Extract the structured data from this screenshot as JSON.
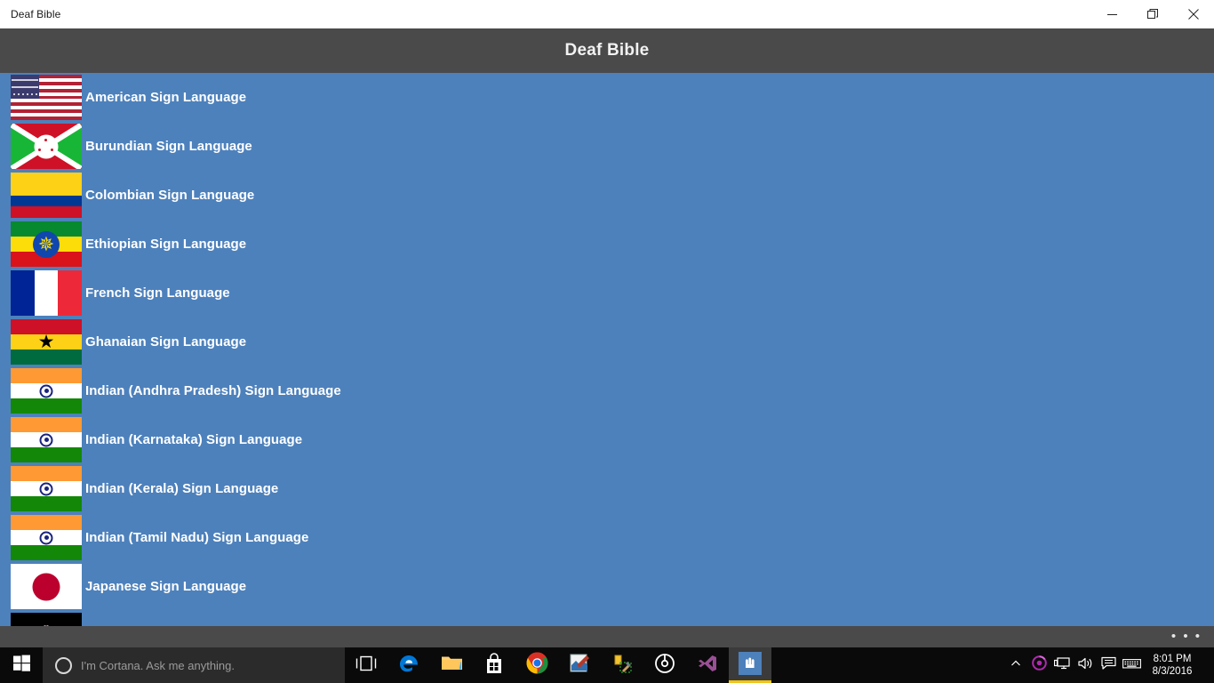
{
  "window": {
    "title": "Deaf Bible",
    "controls": [
      {
        "name": "minimize",
        "label": "Minimize"
      },
      {
        "name": "maximize",
        "label": "Restore"
      },
      {
        "name": "close",
        "label": "Close"
      }
    ]
  },
  "app": {
    "header_title": "Deaf Bible",
    "background_color": "#4d81bc",
    "header_color": "#4a4a4a",
    "appbar_more_label": "• • •"
  },
  "languages": [
    {
      "name": "American Sign Language",
      "flag": "us"
    },
    {
      "name": "Burundian Sign Language",
      "flag": "bi"
    },
    {
      "name": "Colombian Sign Language",
      "flag": "co"
    },
    {
      "name": "Ethiopian Sign Language",
      "flag": "et"
    },
    {
      "name": "French Sign Language",
      "flag": "fr"
    },
    {
      "name": "Ghanaian Sign Language",
      "flag": "gh"
    },
    {
      "name": "Indian (Andhra Pradesh) Sign Language",
      "flag": "in"
    },
    {
      "name": "Indian (Karnataka) Sign Language",
      "flag": "in"
    },
    {
      "name": "Indian (Kerala) Sign Language",
      "flag": "in"
    },
    {
      "name": "Indian (Tamil Nadu) Sign Language",
      "flag": "in"
    },
    {
      "name": "Japanese Sign Language",
      "flag": "jp"
    },
    {
      "name": "",
      "flag": "ke"
    }
  ],
  "taskbar": {
    "start_label": "Start",
    "cortana_placeholder": "I'm Cortana. Ask me anything.",
    "items": [
      {
        "name": "task-view",
        "label": "Task View"
      },
      {
        "name": "microsoft-edge",
        "label": "Microsoft Edge"
      },
      {
        "name": "file-explorer",
        "label": "File Explorer"
      },
      {
        "name": "microsoft-store",
        "label": "Store"
      },
      {
        "name": "google-chrome",
        "label": "Google Chrome"
      },
      {
        "name": "paint",
        "label": "Paint"
      },
      {
        "name": "build-tools",
        "label": "Build Tools"
      },
      {
        "name": "circle-app",
        "label": "Circle App"
      },
      {
        "name": "visual-studio",
        "label": "Visual Studio"
      },
      {
        "name": "deaf-bible-app",
        "label": "Deaf Bible"
      }
    ],
    "tray": [
      {
        "name": "show-hidden-icons",
        "label": "Show hidden icons"
      },
      {
        "name": "sync-app",
        "label": "Sync"
      },
      {
        "name": "network",
        "label": "Network"
      },
      {
        "name": "volume",
        "label": "Volume"
      },
      {
        "name": "action-center",
        "label": "Action Center"
      },
      {
        "name": "touch-keyboard",
        "label": "Touch keyboard"
      }
    ],
    "clock": {
      "time": "8:01 PM",
      "date": "8/3/2016"
    }
  }
}
